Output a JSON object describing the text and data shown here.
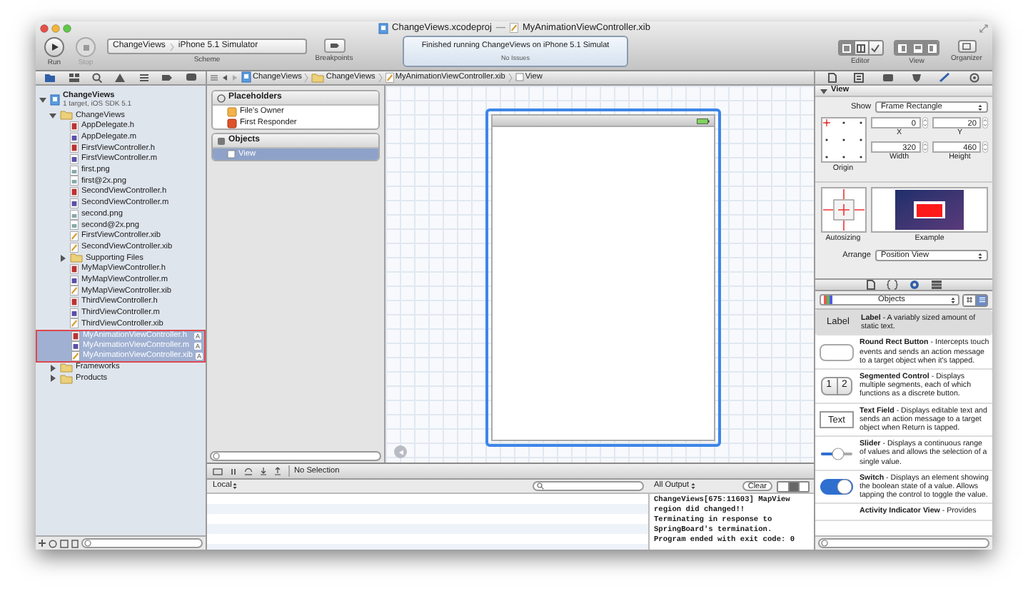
{
  "window": {
    "project_title": "ChangeViews.xcodeproj",
    "separator": "—",
    "file_title": "MyAnimationViewController.xib"
  },
  "toolbar": {
    "run": {
      "label": "Run"
    },
    "stop": {
      "label": "Stop",
      "disabled": true
    },
    "scheme": {
      "target": "ChangeViews",
      "destination": "iPhone 5.1 Simulator",
      "label": "Scheme"
    },
    "breakpoints": {
      "label": "Breakpoints"
    },
    "activity": {
      "message": "Finished running ChangeViews on iPhone 5.1 Simulat",
      "status": "No Issues"
    },
    "editor": {
      "label": "Editor",
      "modes": [
        {
          "kind": "standard",
          "selected": true
        },
        {
          "kind": "assistant",
          "selected": false
        },
        {
          "kind": "version",
          "selected": false
        }
      ]
    },
    "view": {
      "label": "View",
      "panes": [
        {
          "kind": "navigator",
          "on": true
        },
        {
          "kind": "debug",
          "on": true
        },
        {
          "kind": "utilities",
          "on": true
        }
      ]
    },
    "organizer": {
      "label": "Organizer"
    }
  },
  "jump_bar": [
    {
      "kind": "project",
      "label": "ChangeViews"
    },
    {
      "kind": "folder",
      "label": "ChangeViews"
    },
    {
      "kind": "xib",
      "label": "MyAnimationViewController.xib"
    },
    {
      "kind": "view",
      "label": "View"
    }
  ],
  "navigator": {
    "tabs": [
      {
        "kind": "project",
        "selected": true
      },
      {
        "kind": "symbol",
        "selected": false
      },
      {
        "kind": "search",
        "selected": false
      },
      {
        "kind": "issue",
        "selected": false
      },
      {
        "kind": "debug",
        "selected": false
      },
      {
        "kind": "breakpoint",
        "selected": false
      },
      {
        "kind": "log",
        "selected": false
      }
    ],
    "tree": [
      {
        "kind": "project",
        "label": "ChangeViews",
        "subtitle": "1 target, iOS SDK 5.1",
        "expanded": true,
        "selected": false,
        "children": [
          {
            "kind": "folder",
            "label": "ChangeViews",
            "expanded": true,
            "selected": false,
            "children": [
              {
                "kind": "h",
                "label": "AppDelegate.h",
                "selected": false
              },
              {
                "kind": "m",
                "label": "AppDelegate.m",
                "selected": false
              },
              {
                "kind": "h",
                "label": "FirstViewController.h",
                "selected": false
              },
              {
                "kind": "m",
                "label": "FirstViewController.m",
                "selected": false
              },
              {
                "kind": "png",
                "label": "first.png",
                "selected": false
              },
              {
                "kind": "png",
                "label": "first@2x.png",
                "selected": false
              },
              {
                "kind": "h",
                "label": "SecondViewController.h",
                "selected": false
              },
              {
                "kind": "m",
                "label": "SecondViewController.m",
                "selected": false
              },
              {
                "kind": "png",
                "label": "second.png",
                "selected": false
              },
              {
                "kind": "png",
                "label": "second@2x.png",
                "selected": false
              },
              {
                "kind": "xib",
                "label": "FirstViewController.xib",
                "selected": false
              },
              {
                "kind": "xib",
                "label": "SecondViewController.xib",
                "selected": false
              },
              {
                "kind": "folder",
                "label": "Supporting Files",
                "expanded": false,
                "selected": false
              },
              {
                "kind": "h",
                "label": "MyMapViewController.h",
                "selected": false
              },
              {
                "kind": "m",
                "label": "MyMapViewController.m",
                "selected": false
              },
              {
                "kind": "xib",
                "label": "MyMapViewController.xib",
                "selected": false
              },
              {
                "kind": "h",
                "label": "ThirdViewController.h",
                "selected": false
              },
              {
                "kind": "m",
                "label": "ThirdViewController.m",
                "selected": false
              },
              {
                "kind": "xib",
                "label": "ThirdViewController.xib",
                "selected": false
              },
              {
                "kind": "h",
                "label": "MyAnimationViewController.h",
                "selected": true,
                "badge": "A"
              },
              {
                "kind": "m",
                "label": "MyAnimationViewController.m",
                "selected": true,
                "badge": "A"
              },
              {
                "kind": "xib",
                "label": "MyAnimationViewController.xib",
                "selected": true,
                "badge": "A"
              }
            ]
          },
          {
            "kind": "folder",
            "label": "Frameworks",
            "expanded": false,
            "selected": false
          },
          {
            "kind": "folder",
            "label": "Products",
            "expanded": false,
            "selected": false
          }
        ]
      }
    ]
  },
  "outline": {
    "sections": [
      {
        "kind": "placeholders",
        "title": "Placeholders",
        "items": [
          {
            "kind": "owner",
            "label": "File's Owner",
            "selected": false
          },
          {
            "kind": "responder",
            "label": "First Responder",
            "selected": false
          }
        ]
      },
      {
        "kind": "objects",
        "title": "Objects",
        "items": [
          {
            "kind": "view",
            "label": "View",
            "selected": true
          }
        ]
      }
    ]
  },
  "debug": {
    "selection": "No Selection",
    "variables": {
      "scope": "Local"
    },
    "console": {
      "filter": "All Output",
      "clear": "Clear",
      "modes": [
        {
          "selected": false
        },
        {
          "selected": true
        },
        {
          "selected": false
        }
      ],
      "lines": [
        "ChangeViews[675:11603] MapView",
        "region did changed!!",
        "Terminating in response to",
        "SpringBoard's termination.",
        "Program ended with exit code: 0"
      ]
    }
  },
  "inspector": {
    "tabs": [
      {
        "kind": "file",
        "selected": false
      },
      {
        "kind": "help",
        "selected": false
      },
      {
        "kind": "identity",
        "selected": false
      },
      {
        "kind": "attributes",
        "selected": false
      },
      {
        "kind": "size",
        "selected": true
      },
      {
        "kind": "connections",
        "selected": false
      }
    ],
    "section": {
      "title": "View",
      "expanded": true
    },
    "show": {
      "label": "Show",
      "value": "Frame Rectangle"
    },
    "origin_label": "Origin",
    "fields": [
      {
        "label": "X",
        "value": "0"
      },
      {
        "label": "Y",
        "value": "20"
      },
      {
        "label": "Width",
        "value": "320"
      },
      {
        "label": "Height",
        "value": "460"
      }
    ],
    "autosizing_label": "Autosizing",
    "example_label": "Example",
    "arrange": {
      "label": "Arrange",
      "value": "Position View"
    }
  },
  "library": {
    "tabs": [
      {
        "kind": "file",
        "selected": false
      },
      {
        "kind": "code",
        "selected": false
      },
      {
        "kind": "object",
        "selected": true
      },
      {
        "kind": "media",
        "selected": false
      }
    ],
    "category": "Objects",
    "display_modes": [
      {
        "kind": "grid",
        "selected": false
      },
      {
        "kind": "list",
        "selected": true
      }
    ],
    "items": [
      {
        "kind": "label",
        "icon_text": "Label",
        "text": "**Label** - A variably sized amount of static text.",
        "selected": true
      },
      {
        "kind": "button",
        "text": "**Round Rect Button** - Intercepts touch events and sends an action message to a target object when it's tapped.",
        "selected": false
      },
      {
        "kind": "segmented",
        "icon_texts": [
          "1",
          "2"
        ],
        "text": "**Segmented Control** - Displays multiple segments, each of which functions as a discrete button.",
        "selected": false
      },
      {
        "kind": "textfield",
        "icon_text": "Text",
        "text": "**Text Field** - Displays editable text and sends an action message to a target object when Return is tapped.",
        "selected": false
      },
      {
        "kind": "slider",
        "text": "**Slider** - Displays a continuous range of values and allows the selection of a single value.",
        "selected": false
      },
      {
        "kind": "switch",
        "text": "**Switch** - Displays an element showing the boolean state of a value. Allows tapping the control to toggle the value.",
        "selected": false
      },
      {
        "kind": "activity",
        "text": "**Activity Indicator View** - Provides",
        "selected": false
      }
    ]
  }
}
